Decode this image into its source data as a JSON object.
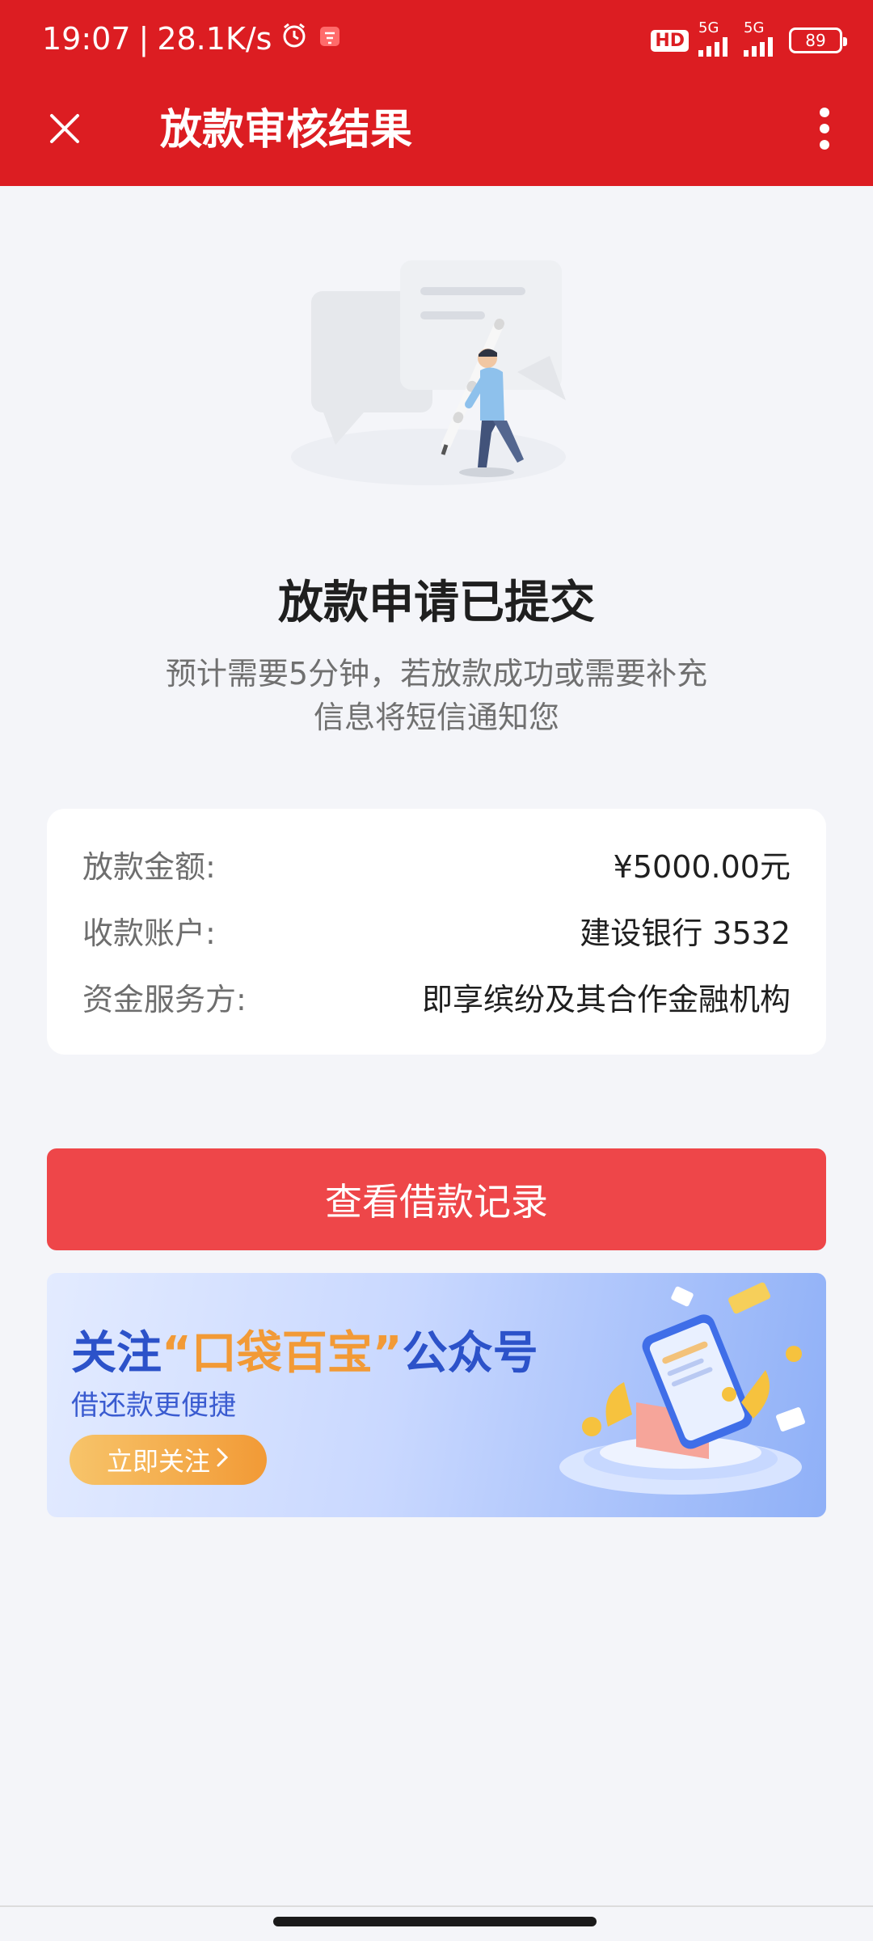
{
  "status_bar": {
    "time": "19:07",
    "speed": "28.1K/s",
    "hd": "HD",
    "net1": "5G",
    "net2": "5G",
    "battery": "89"
  },
  "nav": {
    "title": "放款审核结果",
    "close_icon": "close-icon",
    "more_icon": "more-vertical-icon"
  },
  "result": {
    "headline": "放款申请已提交",
    "subtext_line1": "预计需要5分钟，若放款成功或需要补充",
    "subtext_line2": "信息将短信通知您"
  },
  "details": {
    "rows": [
      {
        "label": "放款金额:",
        "value": "¥5000.00元"
      },
      {
        "label": "收款账户:",
        "value": "建设银行 3532"
      },
      {
        "label": "资金服务方:",
        "value": "即享缤纷及其合作金融机构"
      }
    ]
  },
  "primary_button": {
    "label": "查看借款记录"
  },
  "banner": {
    "title_prefix": "关注",
    "title_highlight": "“口袋百宝”",
    "title_suffix": "公众号",
    "subtitle": "借还款更便捷",
    "button_label": "立即关注",
    "button_icon": "chevron-right-icon"
  },
  "colors": {
    "header_red": "#dc1d22",
    "button_red": "#ee4649",
    "background": "#f4f5f9",
    "banner_blue": "#2c52c9",
    "banner_orange": "#f29a36"
  }
}
